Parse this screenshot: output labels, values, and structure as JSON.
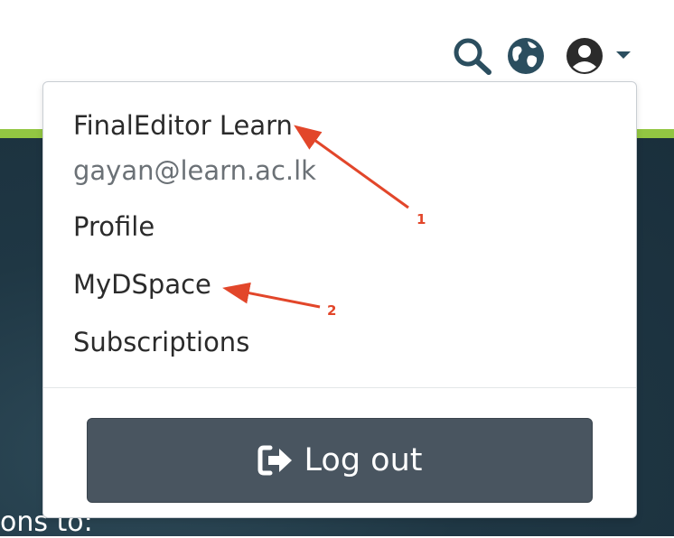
{
  "header": {
    "icons": [
      "search-icon",
      "globe-icon",
      "user-icon",
      "chevron-down-icon"
    ],
    "accent_color": "#2b4e5f",
    "strip_color": "#92c642"
  },
  "dropdown": {
    "user_name": "FinalEditor Learn",
    "user_email": "gayan@learn.ac.lk",
    "items": [
      {
        "label": "Profile"
      },
      {
        "label": "MyDSpace"
      },
      {
        "label": "Subscriptions"
      }
    ],
    "logout_label": "Log out",
    "logout_icon": "sign-out-icon"
  },
  "background": {
    "partial_text": "ons to:"
  },
  "annotations": [
    {
      "label": "1",
      "color": "#e2462a"
    },
    {
      "label": "2",
      "color": "#e2462a"
    }
  ]
}
